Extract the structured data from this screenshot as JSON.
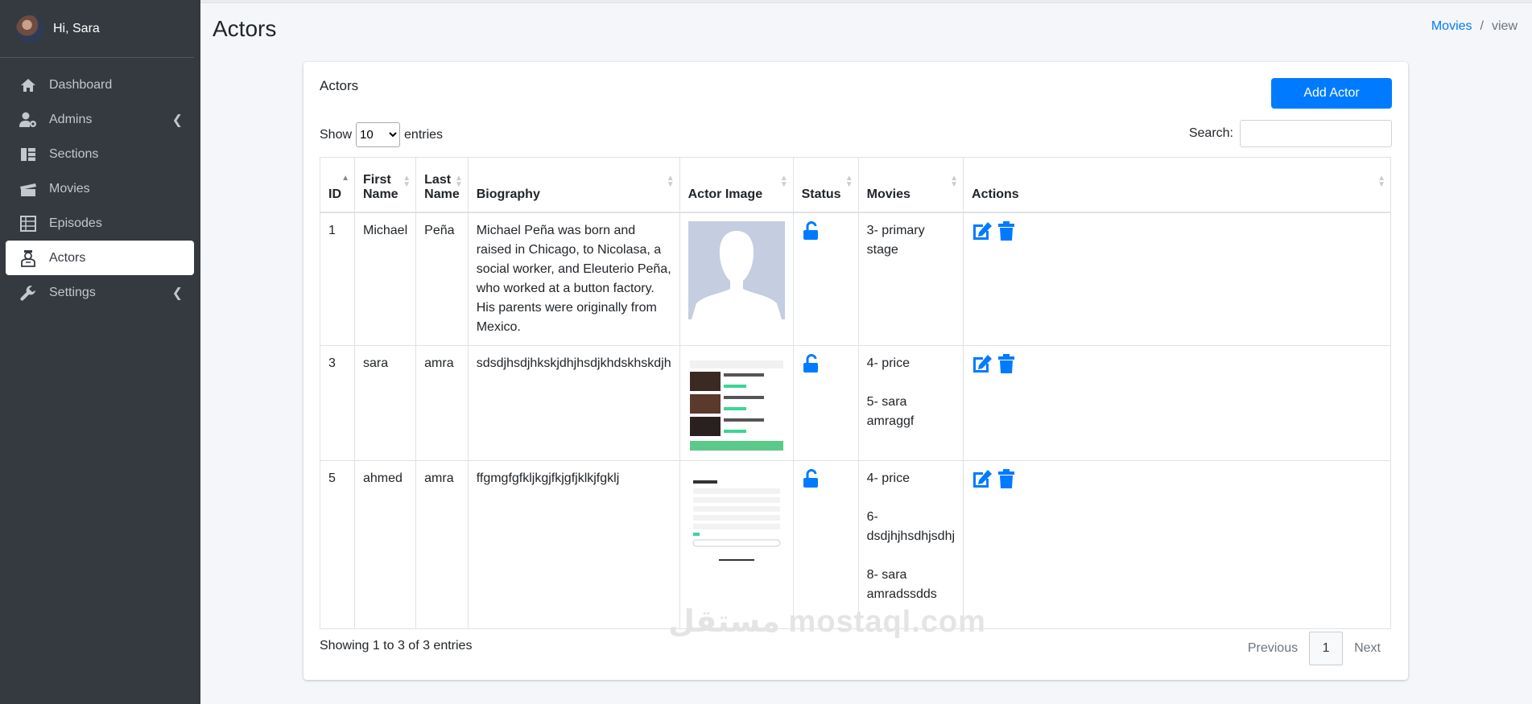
{
  "sidebar": {
    "user_name": "Hi, Sara",
    "items": [
      {
        "label": "Dashboard",
        "icon": "home-icon"
      },
      {
        "label": "Admins",
        "icon": "user-cog-icon",
        "has_submenu": true
      },
      {
        "label": "Sections",
        "icon": "sections-icon"
      },
      {
        "label": "Movies",
        "icon": "clapperboard-icon"
      },
      {
        "label": "Episodes",
        "icon": "episodes-icon"
      },
      {
        "label": "Actors",
        "icon": "actor-icon",
        "active": true
      },
      {
        "label": "Settings",
        "icon": "wrench-icon",
        "has_submenu": true
      }
    ]
  },
  "header": {
    "title": "Actors",
    "breadcrumb": [
      "Movies",
      "view"
    ]
  },
  "card": {
    "title": "Actors",
    "add_button": "Add Actor",
    "length_prefix": "Show",
    "length_value": "10",
    "length_suffix": "entries",
    "search_label": "Search:"
  },
  "table": {
    "headers": [
      "ID",
      "First Name",
      "Last Name",
      "Biography",
      "Actor Image",
      "Status",
      "Movies",
      "Actions"
    ],
    "rows": [
      {
        "id": "1",
        "first": "Michael",
        "last": "Peña",
        "bio": "Michael Peña was born and raised in Chicago, to Nicolasa, a social worker, and Eleuterio Peña, who worked at a button factory. His parents were originally from Mexico.",
        "movies": [
          "3- primary stage"
        ]
      },
      {
        "id": "3",
        "first": "sara",
        "last": "amra",
        "bio": "sdsdjhsdjhkskjdhjhsdjkhdskhskdjh",
        "movies": [
          "4- price",
          "5- sara amraggf"
        ]
      },
      {
        "id": "5",
        "first": "ahmed",
        "last": "amra",
        "bio": "ffgmgfgfkljkgjfkjgfjklkjfgklj",
        "movies": [
          "4- price",
          "6- dsdjhjhsdhjsdhj",
          "8- sara amradssdds"
        ]
      }
    ]
  },
  "footer": {
    "info": "Showing 1 to 3 of 3 entries",
    "previous": "Previous",
    "page": "1",
    "next": "Next"
  },
  "watermark": "مستقل mostaql.com",
  "colors": {
    "sidebar": "#343a40",
    "primary": "#007bff"
  }
}
